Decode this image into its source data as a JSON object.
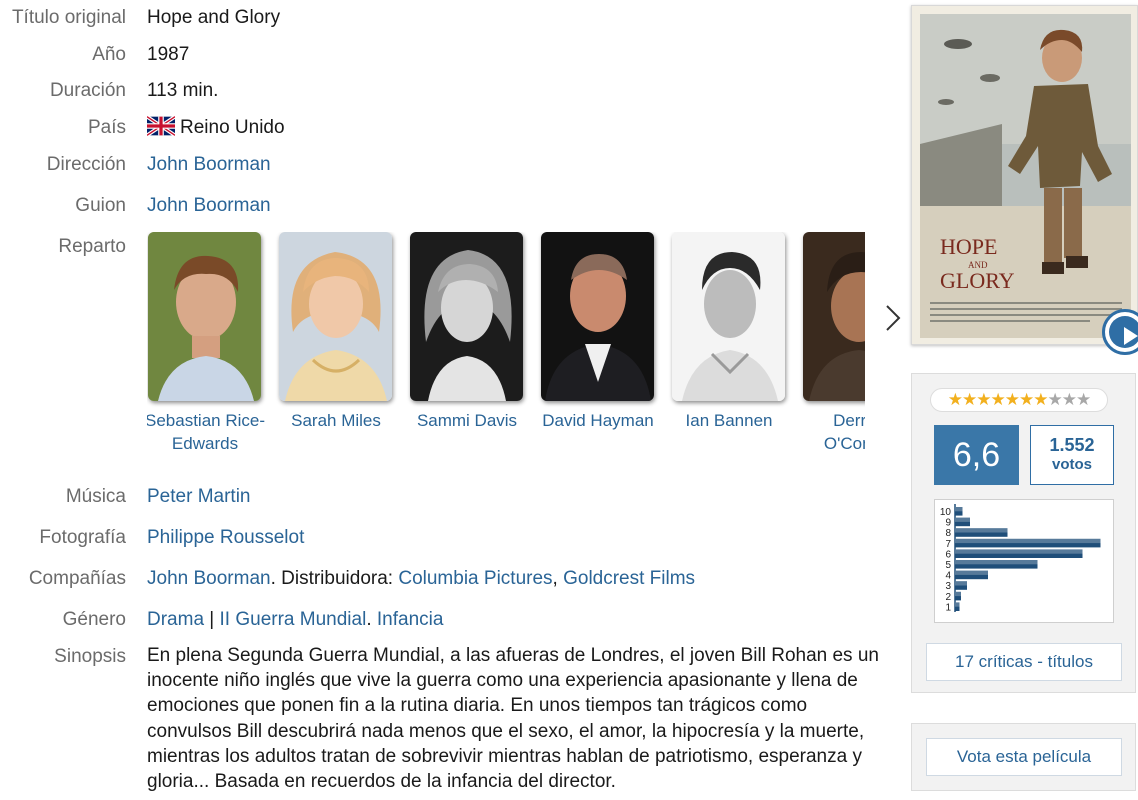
{
  "labels": {
    "original_title": "Título original",
    "year": "Año",
    "duration": "Duración",
    "country": "País",
    "direction": "Dirección",
    "script": "Guion",
    "cast": "Reparto",
    "music": "Música",
    "photography": "Fotografía",
    "companies": "Compañías",
    "genre": "Género",
    "synopsis": "Sinopsis"
  },
  "movie": {
    "original_title": "Hope and Glory",
    "year": "1987",
    "duration": "113 min.",
    "country": "Reino Unido",
    "country_flag": "uk-flag-icon",
    "director": "John Boorman",
    "screenwriter": "John Boorman",
    "music": "Peter Martin",
    "photography": "Philippe Rousselot",
    "company_producer": "John Boorman",
    "distributor_label": ". Distribuidora: ",
    "distributor_1": "Columbia Pictures",
    "separator_comma": ", ",
    "distributor_2": "Goldcrest Films",
    "genre_1": "Drama",
    "genre_sep": " | ",
    "genre_2": "II Guerra Mundial",
    "genre_dot": ". ",
    "genre_3": "Infancia",
    "synopsis": "En plena Segunda Guerra Mundial, a las afueras de Londres, el joven Bill Rohan es un inocente niño inglés que vive la guerra como una experiencia apasionante y llena de emociones que ponen fin a la rutina diaria. En unos tiempos tan trágicos como convulsos Bill descubrirá nada menos que el sexo, el amor, la hipocresía y la muerte, mientras los adultos tratan de sobrevivir mientras hablan de patriotismo, esperanza y gloria... Basada en recuerdos de la infancia del director."
  },
  "cast": [
    {
      "name": "Sebastian Rice-Edwards"
    },
    {
      "name": "Sarah Miles"
    },
    {
      "name": "Sammi Davis"
    },
    {
      "name": "David Hayman"
    },
    {
      "name": "Ian Bannen"
    },
    {
      "name": "Derrick O'Connor"
    }
  ],
  "cast_next_icon": "chevron-right-icon",
  "poster": {
    "title_line1": "HOPE",
    "title_line2": "AND",
    "title_line3": "GLORY"
  },
  "rating": {
    "stars_filled": 7,
    "stars_total": 10,
    "average": "6,6",
    "votes_count": "1.552",
    "votes_label": "votos",
    "histogram_scale": [
      "10",
      "9",
      "8",
      "7",
      "6",
      "5",
      "4",
      "3",
      "2",
      "1"
    ],
    "histogram_values": [
      0.05,
      0.1,
      0.35,
      0.97,
      0.85,
      0.55,
      0.22,
      0.08,
      0.04,
      0.03
    ],
    "critics_link": "17 críticas - títulos",
    "vote_button": "Vota esta película"
  },
  "colors": {
    "accent": "#2f6ea5",
    "link": "#2a6496",
    "histogram_bar": "#1f4e79",
    "star_on": "#f2b01e",
    "star_off": "#a8a8a8"
  }
}
